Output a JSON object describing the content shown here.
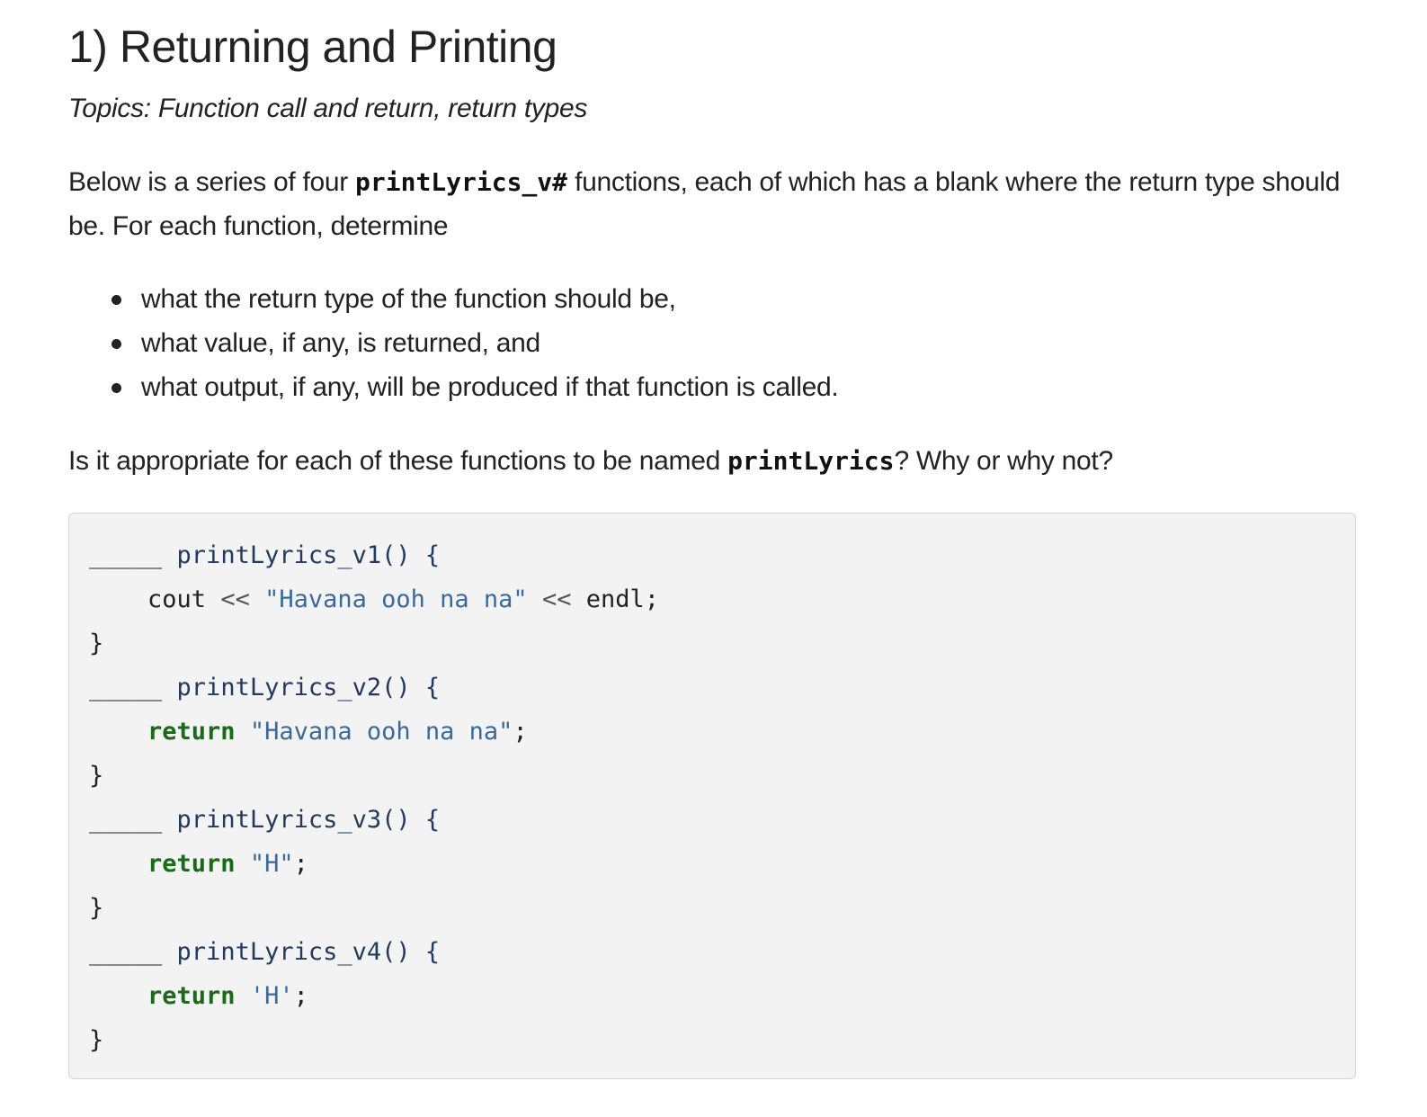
{
  "heading": "1) Returning and Printing",
  "topics": "Topics: Function call and return, return types",
  "intro": {
    "before": "Below is a series of four ",
    "code": "printLyrics_v#",
    "after": " functions, each of which has a blank where the return type should be. For each function, determine"
  },
  "criteria": [
    "what the return type of the function should be,",
    "what value, if any, is returned, and",
    "what output, if any, will be produced if that function is called."
  ],
  "question": {
    "before": "Is it appropriate for each of these functions to be named ",
    "code": "printLyrics",
    "after": "? Why or why not?"
  },
  "code": {
    "functions": [
      {
        "blank": "_____",
        "signature": "printLyrics_v1() {",
        "body": [
          {
            "t": "plain",
            "v": "cout "
          },
          {
            "t": "op",
            "v": "<<"
          },
          {
            "t": "plain",
            "v": " "
          },
          {
            "t": "str",
            "v": "\"Havana ooh na na\""
          },
          {
            "t": "plain",
            "v": " "
          },
          {
            "t": "op",
            "v": "<<"
          },
          {
            "t": "plain",
            "v": " endl;"
          }
        ],
        "close": "}"
      },
      {
        "blank": "_____",
        "signature": "printLyrics_v2() {",
        "body": [
          {
            "t": "kw",
            "v": "return"
          },
          {
            "t": "plain",
            "v": " "
          },
          {
            "t": "str",
            "v": "\"Havana ooh na na\""
          },
          {
            "t": "plain",
            "v": ";"
          }
        ],
        "close": "}"
      },
      {
        "blank": "_____",
        "signature": "printLyrics_v3() {",
        "body": [
          {
            "t": "kw",
            "v": "return"
          },
          {
            "t": "plain",
            "v": " "
          },
          {
            "t": "str",
            "v": "\"H\""
          },
          {
            "t": "plain",
            "v": ";"
          }
        ],
        "close": "}"
      },
      {
        "blank": "_____",
        "signature": "printLyrics_v4() {",
        "body": [
          {
            "t": "kw",
            "v": "return"
          },
          {
            "t": "plain",
            "v": " "
          },
          {
            "t": "str",
            "v": "'H'"
          },
          {
            "t": "plain",
            "v": ";"
          }
        ],
        "close": "}"
      }
    ],
    "colors": {
      "keyword": "#1a6a1a",
      "string": "#3a6a9a",
      "background": "#f3f3f3"
    }
  }
}
